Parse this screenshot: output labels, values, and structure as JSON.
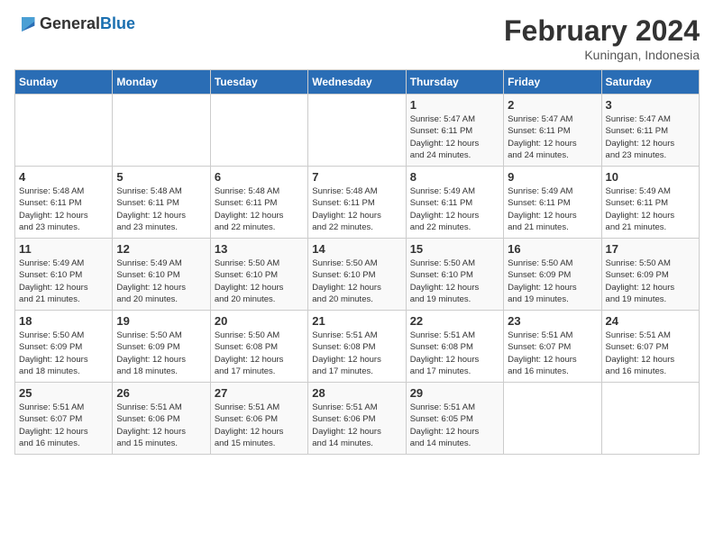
{
  "logo": {
    "general": "General",
    "blue": "Blue"
  },
  "title": "February 2024",
  "subtitle": "Kuningan, Indonesia",
  "days_of_week": [
    "Sunday",
    "Monday",
    "Tuesday",
    "Wednesday",
    "Thursday",
    "Friday",
    "Saturday"
  ],
  "weeks": [
    [
      {
        "day": "",
        "info": ""
      },
      {
        "day": "",
        "info": ""
      },
      {
        "day": "",
        "info": ""
      },
      {
        "day": "",
        "info": ""
      },
      {
        "day": "1",
        "info": "Sunrise: 5:47 AM\nSunset: 6:11 PM\nDaylight: 12 hours\nand 24 minutes."
      },
      {
        "day": "2",
        "info": "Sunrise: 5:47 AM\nSunset: 6:11 PM\nDaylight: 12 hours\nand 24 minutes."
      },
      {
        "day": "3",
        "info": "Sunrise: 5:47 AM\nSunset: 6:11 PM\nDaylight: 12 hours\nand 23 minutes."
      }
    ],
    [
      {
        "day": "4",
        "info": "Sunrise: 5:48 AM\nSunset: 6:11 PM\nDaylight: 12 hours\nand 23 minutes."
      },
      {
        "day": "5",
        "info": "Sunrise: 5:48 AM\nSunset: 6:11 PM\nDaylight: 12 hours\nand 23 minutes."
      },
      {
        "day": "6",
        "info": "Sunrise: 5:48 AM\nSunset: 6:11 PM\nDaylight: 12 hours\nand 22 minutes."
      },
      {
        "day": "7",
        "info": "Sunrise: 5:48 AM\nSunset: 6:11 PM\nDaylight: 12 hours\nand 22 minutes."
      },
      {
        "day": "8",
        "info": "Sunrise: 5:49 AM\nSunset: 6:11 PM\nDaylight: 12 hours\nand 22 minutes."
      },
      {
        "day": "9",
        "info": "Sunrise: 5:49 AM\nSunset: 6:11 PM\nDaylight: 12 hours\nand 21 minutes."
      },
      {
        "day": "10",
        "info": "Sunrise: 5:49 AM\nSunset: 6:11 PM\nDaylight: 12 hours\nand 21 minutes."
      }
    ],
    [
      {
        "day": "11",
        "info": "Sunrise: 5:49 AM\nSunset: 6:10 PM\nDaylight: 12 hours\nand 21 minutes."
      },
      {
        "day": "12",
        "info": "Sunrise: 5:49 AM\nSunset: 6:10 PM\nDaylight: 12 hours\nand 20 minutes."
      },
      {
        "day": "13",
        "info": "Sunrise: 5:50 AM\nSunset: 6:10 PM\nDaylight: 12 hours\nand 20 minutes."
      },
      {
        "day": "14",
        "info": "Sunrise: 5:50 AM\nSunset: 6:10 PM\nDaylight: 12 hours\nand 20 minutes."
      },
      {
        "day": "15",
        "info": "Sunrise: 5:50 AM\nSunset: 6:10 PM\nDaylight: 12 hours\nand 19 minutes."
      },
      {
        "day": "16",
        "info": "Sunrise: 5:50 AM\nSunset: 6:09 PM\nDaylight: 12 hours\nand 19 minutes."
      },
      {
        "day": "17",
        "info": "Sunrise: 5:50 AM\nSunset: 6:09 PM\nDaylight: 12 hours\nand 19 minutes."
      }
    ],
    [
      {
        "day": "18",
        "info": "Sunrise: 5:50 AM\nSunset: 6:09 PM\nDaylight: 12 hours\nand 18 minutes."
      },
      {
        "day": "19",
        "info": "Sunrise: 5:50 AM\nSunset: 6:09 PM\nDaylight: 12 hours\nand 18 minutes."
      },
      {
        "day": "20",
        "info": "Sunrise: 5:50 AM\nSunset: 6:08 PM\nDaylight: 12 hours\nand 17 minutes."
      },
      {
        "day": "21",
        "info": "Sunrise: 5:51 AM\nSunset: 6:08 PM\nDaylight: 12 hours\nand 17 minutes."
      },
      {
        "day": "22",
        "info": "Sunrise: 5:51 AM\nSunset: 6:08 PM\nDaylight: 12 hours\nand 17 minutes."
      },
      {
        "day": "23",
        "info": "Sunrise: 5:51 AM\nSunset: 6:07 PM\nDaylight: 12 hours\nand 16 minutes."
      },
      {
        "day": "24",
        "info": "Sunrise: 5:51 AM\nSunset: 6:07 PM\nDaylight: 12 hours\nand 16 minutes."
      }
    ],
    [
      {
        "day": "25",
        "info": "Sunrise: 5:51 AM\nSunset: 6:07 PM\nDaylight: 12 hours\nand 16 minutes."
      },
      {
        "day": "26",
        "info": "Sunrise: 5:51 AM\nSunset: 6:06 PM\nDaylight: 12 hours\nand 15 minutes."
      },
      {
        "day": "27",
        "info": "Sunrise: 5:51 AM\nSunset: 6:06 PM\nDaylight: 12 hours\nand 15 minutes."
      },
      {
        "day": "28",
        "info": "Sunrise: 5:51 AM\nSunset: 6:06 PM\nDaylight: 12 hours\nand 14 minutes."
      },
      {
        "day": "29",
        "info": "Sunrise: 5:51 AM\nSunset: 6:05 PM\nDaylight: 12 hours\nand 14 minutes."
      },
      {
        "day": "",
        "info": ""
      },
      {
        "day": "",
        "info": ""
      }
    ]
  ]
}
